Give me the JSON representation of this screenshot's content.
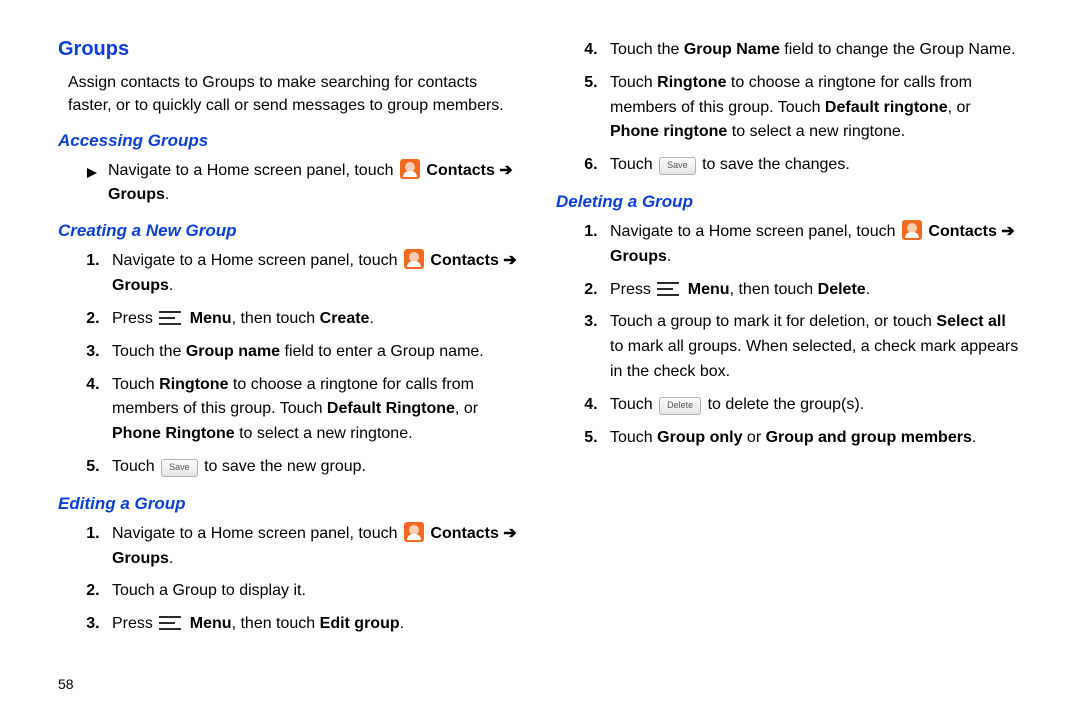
{
  "page_number": "58",
  "title": "Groups",
  "intro": "Assign contacts to Groups to make searching for contacts faster, or to quickly call or send messages to group members.",
  "accessing": {
    "heading": "Accessing Groups",
    "line_a": "Navigate to a Home screen panel, touch ",
    "contacts": "Contacts",
    "arrow": " ➔ ",
    "groups": "Groups",
    "period": "."
  },
  "creating": {
    "heading": "Creating a New Group",
    "s1a": "Navigate to a Home screen panel, touch ",
    "s2a": "Press ",
    "s2b": "Menu",
    "s2c": ", then touch ",
    "s2d": "Create",
    "s3a": "Touch the ",
    "s3b": "Group name",
    "s3c": " field to enter a Group name.",
    "s4a": "Touch ",
    "s4b": "Ringtone",
    "s4c": " to choose a ringtone for calls from members of this group. Touch ",
    "s4d": "Default Ringtone",
    "s4e": ", or ",
    "s4f": "Phone Ringtone",
    "s4g": " to select a new ringtone.",
    "s5a": "Touch ",
    "s5btn": "Save",
    "s5b": " to save the new group."
  },
  "editing": {
    "heading": "Editing a Group",
    "s1a": "Navigate to a Home screen panel, touch ",
    "s2": "Touch a Group to display it.",
    "s3a": "Press ",
    "s3b": "Menu",
    "s3c": ", then touch ",
    "s3d": "Edit group",
    "s4a": "Touch the ",
    "s4b": "Group Name",
    "s4c": " field to change the Group Name.",
    "s5a": "Touch ",
    "s5b": "Ringtone",
    "s5c": " to choose a ringtone for calls from members of this group. Touch ",
    "s5d": "Default ringtone",
    "s5e": ", or ",
    "s5f": "Phone ringtone",
    "s5g": " to select a new ringtone.",
    "s6a": "Touch ",
    "s6btn": "Save",
    "s6b": " to save the changes."
  },
  "deleting": {
    "heading": "Deleting a Group",
    "s1a": "Navigate to a Home screen panel, touch ",
    "s2a": "Press ",
    "s2b": "Menu",
    "s2c": ", then touch ",
    "s2d": "Delete",
    "s3a": "Touch a group to mark it for deletion, or touch ",
    "s3b": "Select all",
    "s3c": " to mark all groups. When selected, a check mark appears in the check box.",
    "s4a": "Touch ",
    "s4btn": "Delete",
    "s4b": " to delete the group(s).",
    "s5a": "Touch ",
    "s5b": "Group only",
    "s5c": " or ",
    "s5d": "Group and group members",
    "s5e": "."
  }
}
